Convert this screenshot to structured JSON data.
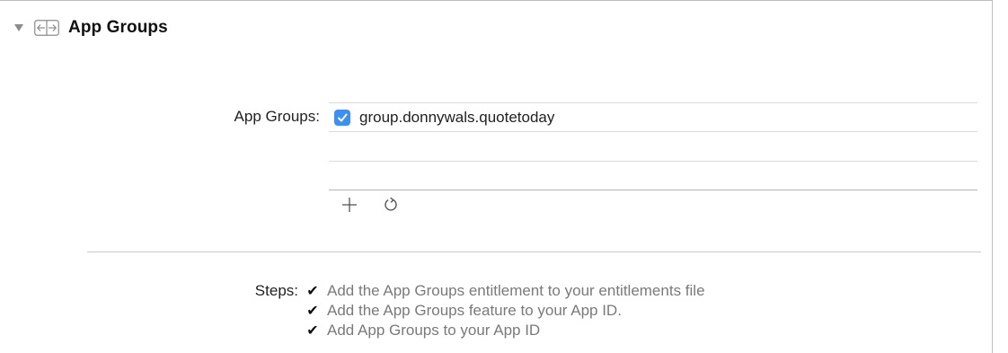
{
  "section": {
    "title": "App Groups",
    "disclosure_icon": "triangle-down-icon",
    "capability_icon": "app-groups-icon"
  },
  "app_groups": {
    "label": "App Groups:",
    "items": [
      {
        "name": "group.donnywals.quotetoday",
        "checked": true
      }
    ],
    "actions": {
      "add_icon": "plus-icon",
      "refresh_icon": "refresh-icon"
    }
  },
  "steps": {
    "label": "Steps:",
    "items": [
      {
        "check": "✔",
        "text": "Add the App Groups entitlement to your entitlements file"
      },
      {
        "check": "✔",
        "text": "Add the App Groups feature to your App ID."
      },
      {
        "check": "✔",
        "text": "Add App Groups to your App ID"
      }
    ]
  },
  "colors": {
    "checkbox_accent": "#3b8ff5",
    "step_text": "#7a7a7a"
  }
}
